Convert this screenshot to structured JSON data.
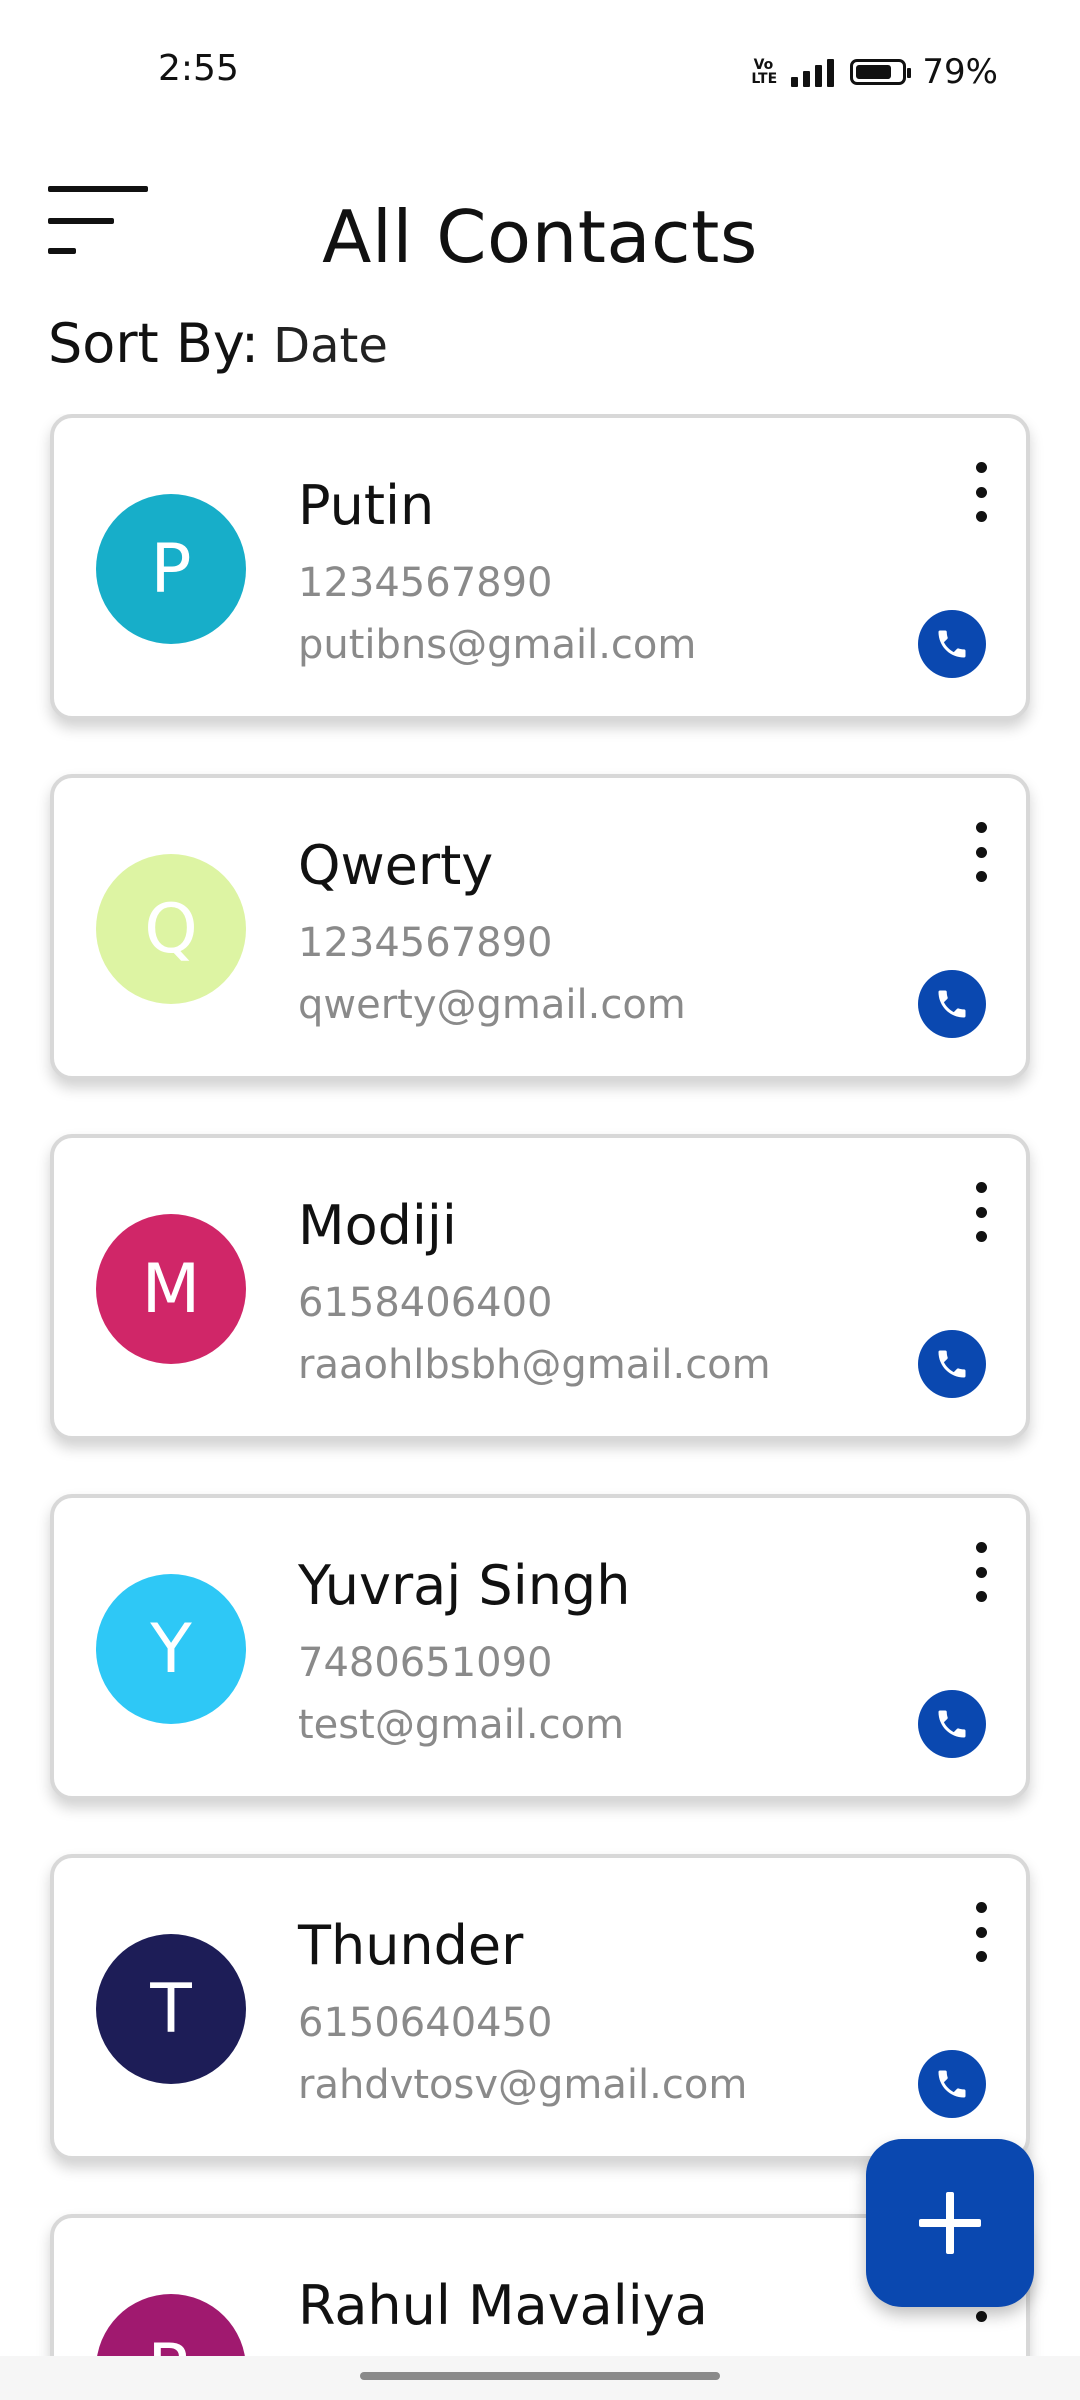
{
  "status_bar": {
    "time": "2:55",
    "network": "Vo LTE",
    "battery_percent_text": "79%",
    "battery_level": 0.79
  },
  "header": {
    "title": "All Contacts",
    "menu_icon": "sort-menu-icon"
  },
  "sort": {
    "label": "Sort By:",
    "value": "Date"
  },
  "contacts": [
    {
      "initial": "P",
      "name": "Putin",
      "phone": "1234567890",
      "email": "putibns@gmail.com",
      "avatar_color": "#17aec9",
      "initial_color": "#ffffff"
    },
    {
      "initial": "Q",
      "name": "Qwerty",
      "phone": "1234567890",
      "email": "qwerty@gmail.com",
      "avatar_color": "#ddf4a3",
      "initial_color": "#ffffff"
    },
    {
      "initial": "M",
      "name": "Modiji",
      "phone": "6158406400",
      "email": "raaohlbsbh@gmail.com",
      "avatar_color": "#d02668",
      "initial_color": "#ffffff"
    },
    {
      "initial": "Y",
      "name": "Yuvraj Singh",
      "phone": "7480651090",
      "email": "test@gmail.com",
      "avatar_color": "#2ec8f6",
      "initial_color": "#ffffff"
    },
    {
      "initial": "T",
      "name": "Thunder",
      "phone": "6150640450",
      "email": "rahdvtosv@gmail.com",
      "avatar_color": "#1d1d57",
      "initial_color": "#ffffff"
    },
    {
      "initial": "R",
      "name": "Rahul Mavaliya",
      "phone": "",
      "email": "",
      "avatar_color": "#a0196f",
      "initial_color": "#ffffff"
    }
  ],
  "icons": {
    "call": "phone-icon",
    "more": "more-vertical-icon",
    "add": "plus-icon"
  },
  "colors": {
    "accent": "#0a48b0",
    "secondary_text": "#8a8a8a"
  }
}
